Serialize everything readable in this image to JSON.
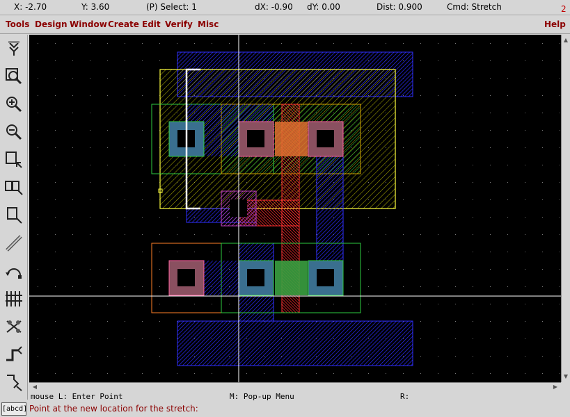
{
  "status": {
    "x": "X: -2.70",
    "y": "Y: 3.60",
    "select": "(P) Select: 1",
    "dx": "dX: -0.90",
    "dy": "dY: 0.00",
    "dist": "Dist: 0.900",
    "cmd": "Cmd: Stretch",
    "window_number": "2"
  },
  "menu": {
    "tools": "Tools",
    "design": "Design",
    "window": "Window",
    "create": "Create",
    "edit": "Edit",
    "verify": "Verify",
    "misc": "Misc",
    "help": "Help"
  },
  "toolbar": {
    "icons": [
      "push-down-icon",
      "zoom-fit-icon",
      "zoom-in-icon",
      "zoom-out-icon",
      "select-box-icon",
      "select-multi-icon",
      "select-object-icon",
      "wire-icon",
      "undo-arc-icon",
      "grid-icon",
      "layers-icon",
      "path-icon",
      "polygon-icon"
    ]
  },
  "mouse_hints": {
    "left": "mouse L: Enter Point",
    "middle": "M: Pop-up Menu",
    "right": "R:"
  },
  "keybox": "[abcd]",
  "prompt": "Point at the new location for the stretch:",
  "layers": {
    "metal1": "#1a1aff",
    "poly": "#ff2020",
    "active": "#2ecc40",
    "selection": "#ffff33"
  }
}
